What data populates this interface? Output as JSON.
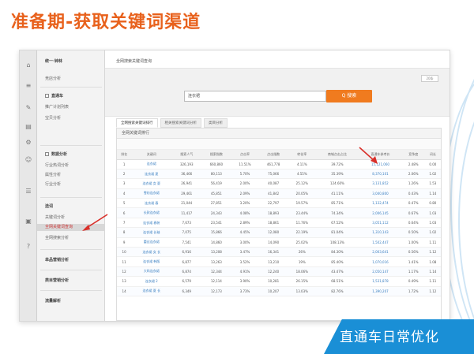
{
  "slide": {
    "title": "准备期-获取关键词渠道",
    "banner": "直通车日常优化"
  },
  "colors": {
    "title": "#e8611c",
    "banner": "#1a8fd6",
    "search_button": "#f07b1f",
    "arrow": "#d9302a",
    "link": "#3a7fc1"
  },
  "icons": [
    "home-icon",
    "menu-icon",
    "tool-icon",
    "chart-icon",
    "settings-icon",
    "user-icon",
    "list-icon",
    "doc-icon",
    "help-icon"
  ],
  "sidebar": {
    "items": [
      {
        "label": "统一·钟林",
        "kind": "group"
      },
      {
        "label": "竞店分析",
        "kind": "item"
      },
      {
        "label": "直通车",
        "kind": "group"
      },
      {
        "label": "推广计划列表",
        "kind": "item"
      },
      {
        "label": "宝贝分析",
        "kind": "item"
      },
      {
        "label": "数据分析",
        "kind": "group"
      },
      {
        "label": "行业热词分析",
        "kind": "item"
      },
      {
        "label": "属性分析",
        "kind": "item"
      },
      {
        "label": "行业分析",
        "kind": "item"
      },
      {
        "label": "选词",
        "kind": "group"
      },
      {
        "label": "关键词分析",
        "kind": "item"
      },
      {
        "label": "全网关键词查询",
        "kind": "active"
      },
      {
        "label": "全网搜索分析",
        "kind": "item"
      },
      {
        "label": "单品营销分析",
        "kind": "group"
      },
      {
        "label": "类目营销分析",
        "kind": "group"
      },
      {
        "label": "流量解析",
        "kind": "group"
      }
    ]
  },
  "main": {
    "page_title": "全网搜索关键词查询",
    "page_size": "20条",
    "search_value": "连衣裙",
    "search_button": "Q 搜索",
    "tabs": [
      "全网搜索关键词排行",
      "相关搜索关键词分析",
      "类目分析"
    ],
    "table_caption": "全网关键词排行"
  },
  "table": {
    "headers": [
      "排名",
      "关键词",
      "搜索人气",
      "搜索指数",
      "点击率",
      "点击指数",
      "转化率",
      "商城点击占比",
      "直通车参考价",
      "竞争度",
      "词长"
    ],
    "rows": [
      [
        "1",
        "连衣裙",
        "326,193",
        "660,860",
        "11.51%",
        "461,778",
        "4.11%",
        "39.72%",
        "15,121,060",
        "2.48%",
        "0.00"
      ],
      [
        "2",
        "连衣裙 夏",
        "36,466",
        "80,113",
        "5.70%",
        "75,066",
        "4.55%",
        "35.39%",
        "8,370,101",
        "2.06%",
        "1.02"
      ],
      [
        "3",
        "连衣裙 女 夏",
        "26,941",
        "56,419",
        "2.00%",
        "40,087",
        "25.12%",
        "124.60%",
        "3,131,852",
        "1.26%",
        "1.53"
      ],
      [
        "4",
        "雪纺连衣裙",
        "29,461",
        "45,851",
        "2.09%",
        "41,842",
        "20.05%",
        "41.11%",
        "3,040,800",
        "0.43%",
        "1.14"
      ],
      [
        "5",
        "连衣裙 春",
        "21,044",
        "27,851",
        "3.20%",
        "22,797",
        "19.57%",
        "85.71%",
        "1,132,474",
        "0.47%",
        "0.80"
      ],
      [
        "6",
        "长款连衣裙",
        "11,417",
        "24,343",
        "4.08%",
        "18,893",
        "23.44%",
        "74.34%",
        "2,006,145",
        "0.67%",
        "1.03"
      ],
      [
        "7",
        "连衣裙 春装",
        "7,673",
        "23,541",
        "2.89%",
        "18,861",
        "11.76%",
        "67.52%",
        "3,051,112",
        "0.64%",
        "1.03"
      ],
      [
        "8",
        "连衣裙 长袖",
        "7,075",
        "15,866",
        "4.45%",
        "12,080",
        "22.19%",
        "81.04%",
        "1,310,143",
        "0.50%",
        "1.02"
      ],
      [
        "9",
        "蕾丝连衣裙",
        "7,541",
        "14,860",
        "3.00%",
        "14,090",
        "25.02%",
        "108.13%",
        "1,502,447",
        "1.00%",
        "1.11"
      ],
      [
        "10",
        "连衣裙 女 长",
        "6,916",
        "13,208",
        "3.47%",
        "16,341",
        "26%",
        "84.30%",
        "2,003,641",
        "0.56%",
        "1.12"
      ],
      [
        "11",
        "连衣裙 韩版",
        "6,877",
        "13,263",
        "3.52%",
        "13,210",
        "19%",
        "85.40%",
        "1,070,016",
        "1.41%",
        "1.08"
      ],
      [
        "12",
        "大码连衣裙",
        "6,874",
        "12,344",
        "4.91%",
        "12,240",
        "18.06%",
        "43.47%",
        "2,050,147",
        "1.17%",
        "1.14"
      ],
      [
        "13",
        "连衣裙 2",
        "6,579",
        "12,114",
        "3.90%",
        "10,281",
        "26.15%",
        "68.51%",
        "1,531,878",
        "0.49%",
        "1.11"
      ],
      [
        "14",
        "连衣裙 夏 长",
        "6,349",
        "12,173",
        "3.73%",
        "10,207",
        "13.03%",
        "82.76%",
        "1,390,207",
        "1.72%",
        "1.12"
      ]
    ]
  }
}
